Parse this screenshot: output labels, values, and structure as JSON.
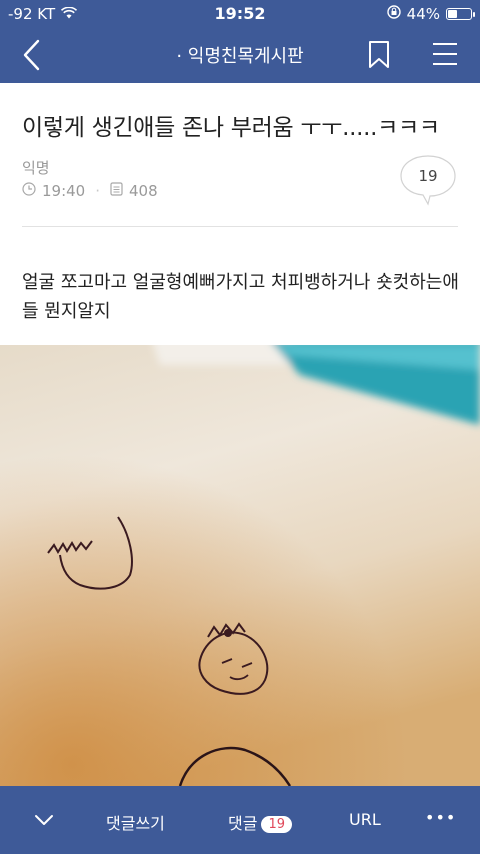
{
  "status": {
    "carrier": "-92 KT",
    "time": "19:52",
    "battery": "44%",
    "battery_level": 0.44
  },
  "nav": {
    "title": "· 익명친목게시판"
  },
  "post": {
    "title": "이렇게 생긴애들 존나 부러움 ㅜㅜ.....ㅋㅋㅋ",
    "author": "익명",
    "time": "19:40",
    "views": "408",
    "comment_count": "19",
    "body": "얼굴 쪼고마고 얼굴형예뻐가지고 처피뱅하거나 숏컷하는애들 뭔지알지"
  },
  "bottom": {
    "write_comment": "댓글쓰기",
    "comments": "댓글",
    "comments_count": "19",
    "url": "URL",
    "more": "•••"
  },
  "colors": {
    "bar": "#3e5a98",
    "badge_text": "#e0485a"
  },
  "icons": [
    "wifi-icon",
    "alarm-lock-icon",
    "battery-icon",
    "back-icon",
    "bookmark-icon",
    "menu-icon",
    "clock-icon",
    "views-icon",
    "comment-bubble-icon",
    "chevron-down-icon"
  ]
}
